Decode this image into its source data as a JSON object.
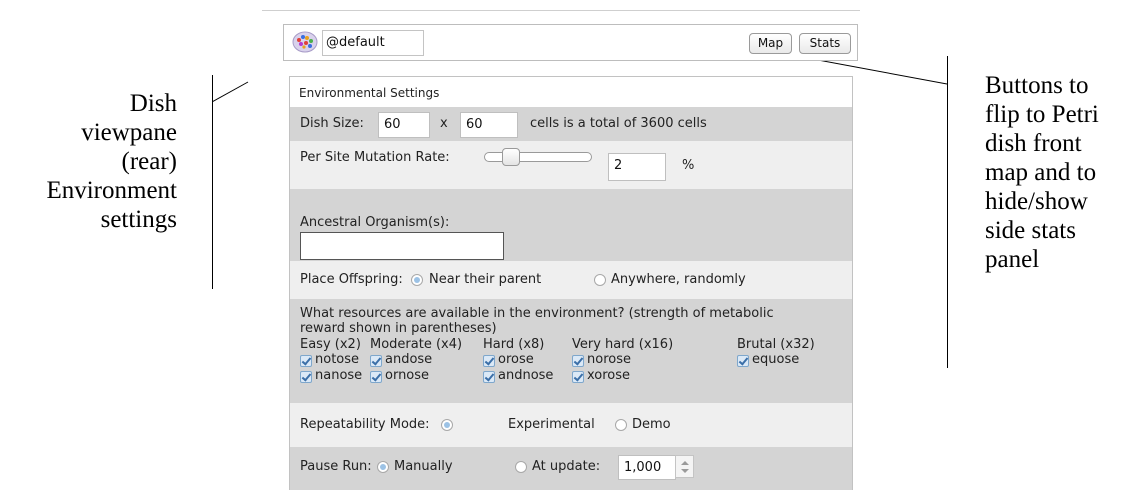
{
  "annotations": {
    "left_lines": [
      "Dish",
      "viewpane",
      "(rear)",
      "Environment",
      "settings"
    ],
    "right_lines": [
      "Buttons to",
      "flip to Petri",
      "dish front",
      "map and to",
      "hide/show",
      "side stats",
      "panel"
    ]
  },
  "header": {
    "organism_name": "@default",
    "map_label": "Map",
    "stats_label": "Stats"
  },
  "settings": {
    "title": "Environmental Settings",
    "dish_size": {
      "label": "Dish Size:",
      "width": "60",
      "times": "x",
      "height": "60",
      "summary": "cells is a total of 3600 cells"
    },
    "mutation": {
      "label": "Per Site Mutation Rate:",
      "value": "2",
      "unit": "%",
      "slider_fraction": 0.2
    },
    "ancestral": {
      "label": "Ancestral Organism(s):",
      "value": ""
    },
    "offspring": {
      "label": "Place Offspring:",
      "option_near": "Near their parent",
      "option_anywhere": "Anywhere, randomly",
      "selected": "Near their parent"
    },
    "resources": {
      "question_line1": "What resources are available in the environment? (strength of metabolic",
      "question_line2": "reward shown in parentheses)",
      "groups": [
        {
          "header": "Easy (x2)",
          "items": [
            "notose",
            "nanose"
          ]
        },
        {
          "header": "Moderate (x4)",
          "items": [
            "andose",
            "ornose"
          ]
        },
        {
          "header": "Hard (x8)",
          "items": [
            "orose",
            "andnose"
          ]
        },
        {
          "header": "Very hard (x16)",
          "items": [
            "norose",
            "xorose"
          ]
        },
        {
          "header": "Brutal (x32)",
          "items": [
            "equose"
          ]
        }
      ]
    },
    "repeatability": {
      "label": "Repeatability Mode:",
      "option_experimental": "Experimental",
      "option_demo": "Demo",
      "selected": "Experimental"
    },
    "pause": {
      "label": "Pause Run:",
      "option_manual": "Manually",
      "option_update": "At update:",
      "update_value": "1,000",
      "selected": "Manually"
    }
  }
}
